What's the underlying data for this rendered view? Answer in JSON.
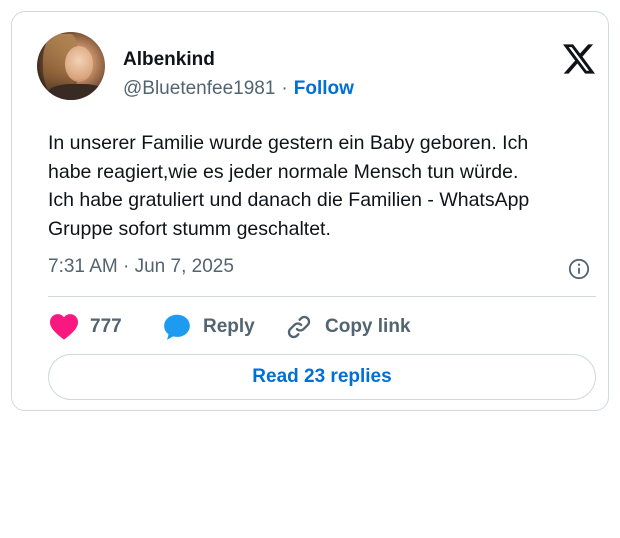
{
  "author": {
    "display_name": "Albenkind",
    "handle": "@Bluetenfee1981",
    "separator": "·",
    "follow_label": "Follow"
  },
  "tweet": {
    "lines": [
      "In unserer Familie wurde gestern ein Baby geboren. Ich",
      "habe reagiert,wie es jeder normale Mensch tun würde.",
      "Ich habe gratuliert und danach die Familien - WhatsApp",
      "Gruppe sofort stumm geschaltet."
    ],
    "timestamp": "7:31 AM · Jun 7, 2025"
  },
  "actions": {
    "like_count": "777",
    "reply_label": "Reply",
    "copy_label": "Copy link",
    "read_replies_label": "Read 23 replies"
  },
  "icons": {
    "logo": "x-logo-icon",
    "info": "info-icon",
    "like": "heart-icon",
    "reply": "speech-bubble-icon",
    "copy": "link-icon"
  },
  "colors": {
    "accent": "#006fd6",
    "like": "#f91880",
    "reply": "#1d9bf0",
    "muted": "#536471",
    "border": "#cfd9de"
  }
}
